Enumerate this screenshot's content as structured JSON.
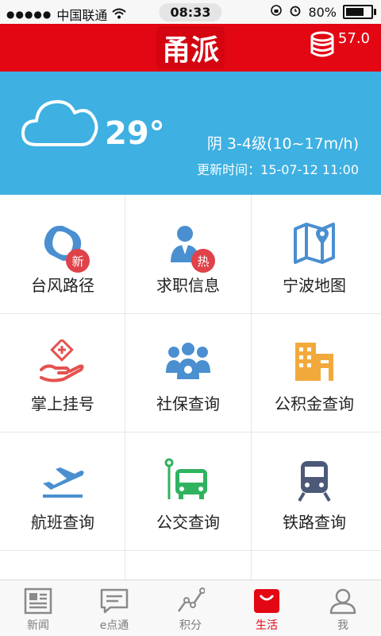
{
  "status_bar": {
    "carrier": "中国联通",
    "time": "08:33",
    "battery": "80%",
    "battery_level": 0.8
  },
  "header": {
    "logo_text": "甬派",
    "coins": "57.0"
  },
  "weather": {
    "temperature": "29°",
    "condition": "阴  3-4级(10~17m/h)",
    "updated": "更新时间：15-07-12  11:00"
  },
  "services": [
    {
      "label": "台风路径",
      "icon": "typhoon-icon",
      "badge": "新",
      "color": "#4a8fd0"
    },
    {
      "label": "求职信息",
      "icon": "job-seeker-icon",
      "badge": "热",
      "color": "#4a8fd0"
    },
    {
      "label": "宁波地图",
      "icon": "map-icon",
      "badge": "",
      "color": "#4a8fd0"
    },
    {
      "label": "掌上挂号",
      "icon": "medical-hand-icon",
      "badge": "",
      "color": "#e3524f"
    },
    {
      "label": "社保查询",
      "icon": "people-group-icon",
      "badge": "",
      "color": "#4a8fd0"
    },
    {
      "label": "公积金查询",
      "icon": "buildings-icon",
      "badge": "",
      "color": "#f2a93b"
    },
    {
      "label": "航班查询",
      "icon": "airplane-icon",
      "badge": "",
      "color": "#4a8fd0"
    },
    {
      "label": "公交查询",
      "icon": "bus-icon",
      "badge": "",
      "color": "#2fb35e"
    },
    {
      "label": "铁路查询",
      "icon": "train-icon",
      "badge": "",
      "color": "#4c5a78"
    }
  ],
  "tabs": [
    {
      "label": "新闻",
      "icon": "newspaper-icon",
      "active": false
    },
    {
      "label": "e点通",
      "icon": "message-icon",
      "active": false
    },
    {
      "label": "积分",
      "icon": "chart-line-icon",
      "active": false
    },
    {
      "label": "生活",
      "icon": "shopping-bag-icon",
      "active": true
    },
    {
      "label": "我",
      "icon": "person-icon",
      "active": false
    }
  ],
  "colors": {
    "brand_red": "#e30613",
    "weather_blue": "#3eb0e2"
  }
}
